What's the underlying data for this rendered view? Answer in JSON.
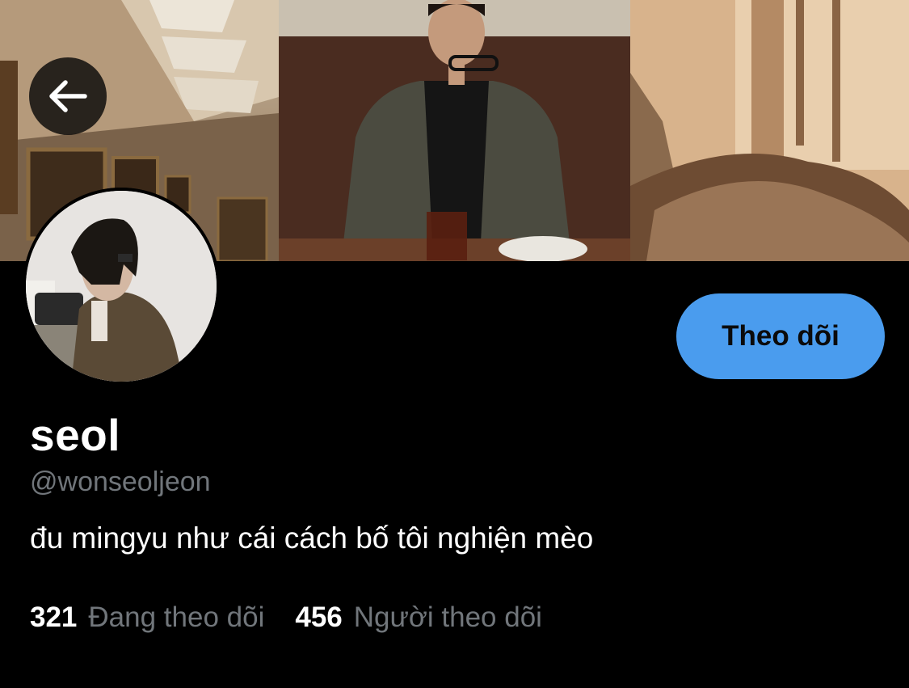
{
  "header": {
    "back_icon": "arrow-left-icon"
  },
  "profile": {
    "display_name": "seol",
    "handle": "@wonseoljeon",
    "bio": "đu mingyu như cái cách bố tôi nghiện mèo",
    "follow_button_label": "Theo dõi",
    "stats": {
      "following_count": "321",
      "following_label": "Đang theo dõi",
      "followers_count": "456",
      "followers_label": "Người theo dõi"
    }
  },
  "colors": {
    "background": "#000000",
    "accent": "#4a9cee",
    "secondary_text": "#71767b",
    "primary_text": "#ffffff"
  }
}
